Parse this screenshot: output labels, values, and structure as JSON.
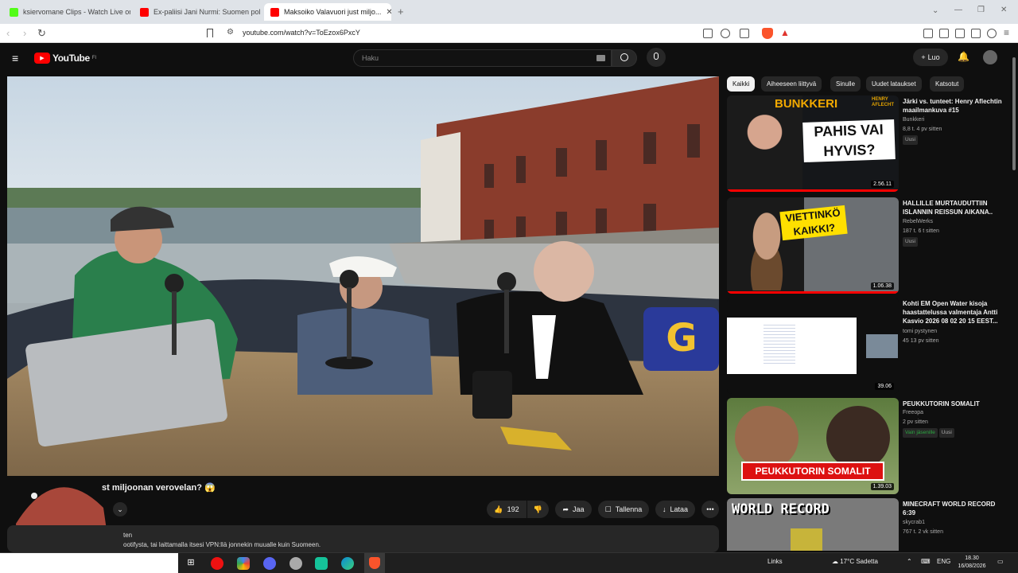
{
  "browser": {
    "tabs": [
      {
        "label": "ksiervomane Clips - Watch Live on Kick",
        "fav_color": "#53fc18"
      },
      {
        "label": "Ex-paliisi Jani Nurmi: Suomen poliisi...",
        "fav_color": "#ff0000"
      },
      {
        "label": "Maksoiko Valavuori just miljo...",
        "fav_color": "#ff0000",
        "active": true
      }
    ],
    "new_tab": "+",
    "url": "youtube.com/watch?v=ToEzox6PxcY"
  },
  "youtube": {
    "logo_text": "YouTube",
    "logo_sup": "FI",
    "search_placeholder": "Haku",
    "create_label": "Luo"
  },
  "video": {
    "title_partial": "st miljoonan verovelan? 😱",
    "likes": "192",
    "share_label": "Jaa",
    "save_label": "Tallenna",
    "download_label": "Lataa",
    "more_label": "•••",
    "desc_line1": "ten",
    "desc_line2": "ootifysta, tai laittamalla itsesi VPN:llä jonnekin muualle kuin Suomeen."
  },
  "chips": [
    "Kaikki",
    "Aiheeseen liittyvä",
    "Sinulle",
    "Uudet lataukset",
    "Katsotut"
  ],
  "recommendations": [
    {
      "title": "Järki vs. tunteet: Henry Aflechtin maailmankuva #15",
      "channel": "Bunkkeri",
      "meta": "8,8 t.  4 pv sitten",
      "badge": "Uusi",
      "duration": "2.56.11",
      "thumb_text1": "BUNKKERI",
      "thumb_text2": "PAHIS VAI HYVIS?",
      "thumb_text3": "HENRY AFLECHT"
    },
    {
      "title": "HALLILLE MURTAUDUTTIIN ISLANNIN REISSUN AIKANA..",
      "channel": "RebelWerks",
      "meta": "187 t.  6 t sitten",
      "badge": "Uusi",
      "duration": "1.06.38",
      "thumb_text1": "VIETTINKÖ KAIKKI?"
    },
    {
      "title": "Kohti EM Open Water kisoja haastattelussa valmentaja  Antti Kasvio  2026 08 02 20 15 EEST...",
      "channel": "tomi pystynen",
      "meta": "45  13 pv sitten",
      "badge": "",
      "duration": "39.06"
    },
    {
      "title": "PEUKKUTORIN SOMALIT",
      "channel": "Freeopa",
      "meta": "2 pv sitten",
      "badge": "Uusi",
      "badge2": "Vain jäsenille",
      "duration": "1.39.03",
      "thumb_text1": "PEUKKUTORIN SOMALIT"
    },
    {
      "title": "MINECRAFT WORLD RECORD 6:39",
      "channel": "skycrab1",
      "meta": "767 t.  2 vk sitten",
      "badge": "",
      "duration": "",
      "thumb_text1": "WORLD RECORD"
    }
  ],
  "taskbar": {
    "links_label": "Links",
    "weather": "17°C  Sadetta",
    "lang": "ENG",
    "time": "18.30",
    "date": "16/08/2026"
  },
  "colors": {
    "yt_red": "#ff0000",
    "bg": "#0f0f0f",
    "accent_green": "#2ba640"
  }
}
